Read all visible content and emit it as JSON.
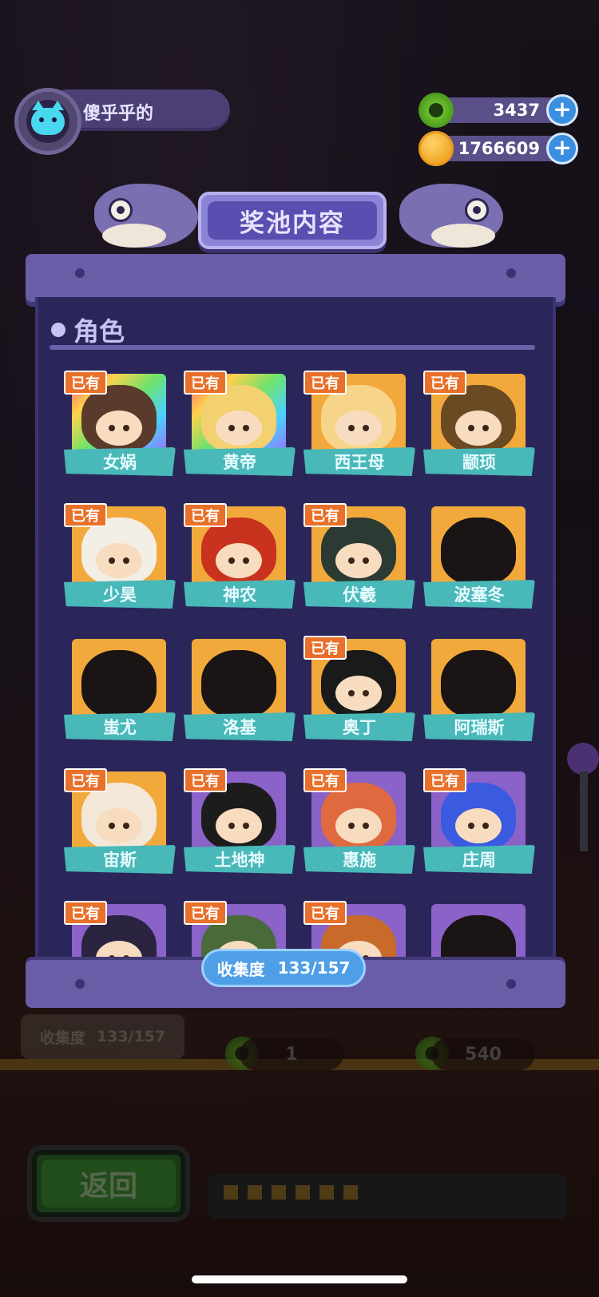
{
  "header": {
    "username": "傻乎乎的",
    "currencies": [
      {
        "icon": "green-coin-icon",
        "value": "3437"
      },
      {
        "icon": "planet-coin-icon",
        "value": "1766609"
      }
    ],
    "plus_label": "+"
  },
  "modal": {
    "title": "奖池内容",
    "section_label": "角色",
    "owned_label": "已有",
    "characters": [
      {
        "name": "女娲",
        "owned": true,
        "frame": "rainbow"
      },
      {
        "name": "黄帝",
        "owned": true,
        "frame": "rainbow"
      },
      {
        "name": "西王母",
        "owned": true,
        "frame": "gold"
      },
      {
        "name": "颛顼",
        "owned": true,
        "frame": "gold"
      },
      {
        "name": "少昊",
        "owned": true,
        "frame": "gold"
      },
      {
        "name": "神农",
        "owned": true,
        "frame": "gold"
      },
      {
        "name": "伏羲",
        "owned": true,
        "frame": "gold"
      },
      {
        "name": "波塞冬",
        "owned": false,
        "frame": "gold"
      },
      {
        "name": "蚩尤",
        "owned": false,
        "frame": "gold"
      },
      {
        "name": "洛基",
        "owned": false,
        "frame": "gold"
      },
      {
        "name": "奥丁",
        "owned": true,
        "frame": "gold"
      },
      {
        "name": "阿瑞斯",
        "owned": false,
        "frame": "gold"
      },
      {
        "name": "宙斯",
        "owned": true,
        "frame": "gold"
      },
      {
        "name": "土地神",
        "owned": true,
        "frame": "purple"
      },
      {
        "name": "惠施",
        "owned": true,
        "frame": "purple"
      },
      {
        "name": "庄周",
        "owned": true,
        "frame": "purple"
      },
      {
        "name": "",
        "owned": true,
        "frame": "purple"
      },
      {
        "name": "",
        "owned": true,
        "frame": "purple"
      },
      {
        "name": "",
        "owned": true,
        "frame": "purple"
      },
      {
        "name": "",
        "owned": false,
        "frame": "purple"
      }
    ],
    "progress_label": "收集度",
    "progress_value": "133/157",
    "progress_fraction": 0.847
  },
  "background": {
    "collect_label": "收集度",
    "collect_value": "133/157",
    "stat_one": "1",
    "stat_two": "540",
    "back_label": "返回"
  },
  "colors": {
    "panel": "#6a5da8",
    "panel_inner": "#2b265a",
    "name_bar": "#49b8b9",
    "owned_tag": "#e8702a",
    "gold_frame": "#f2a93b",
    "purple_frame": "#8a62c8"
  }
}
